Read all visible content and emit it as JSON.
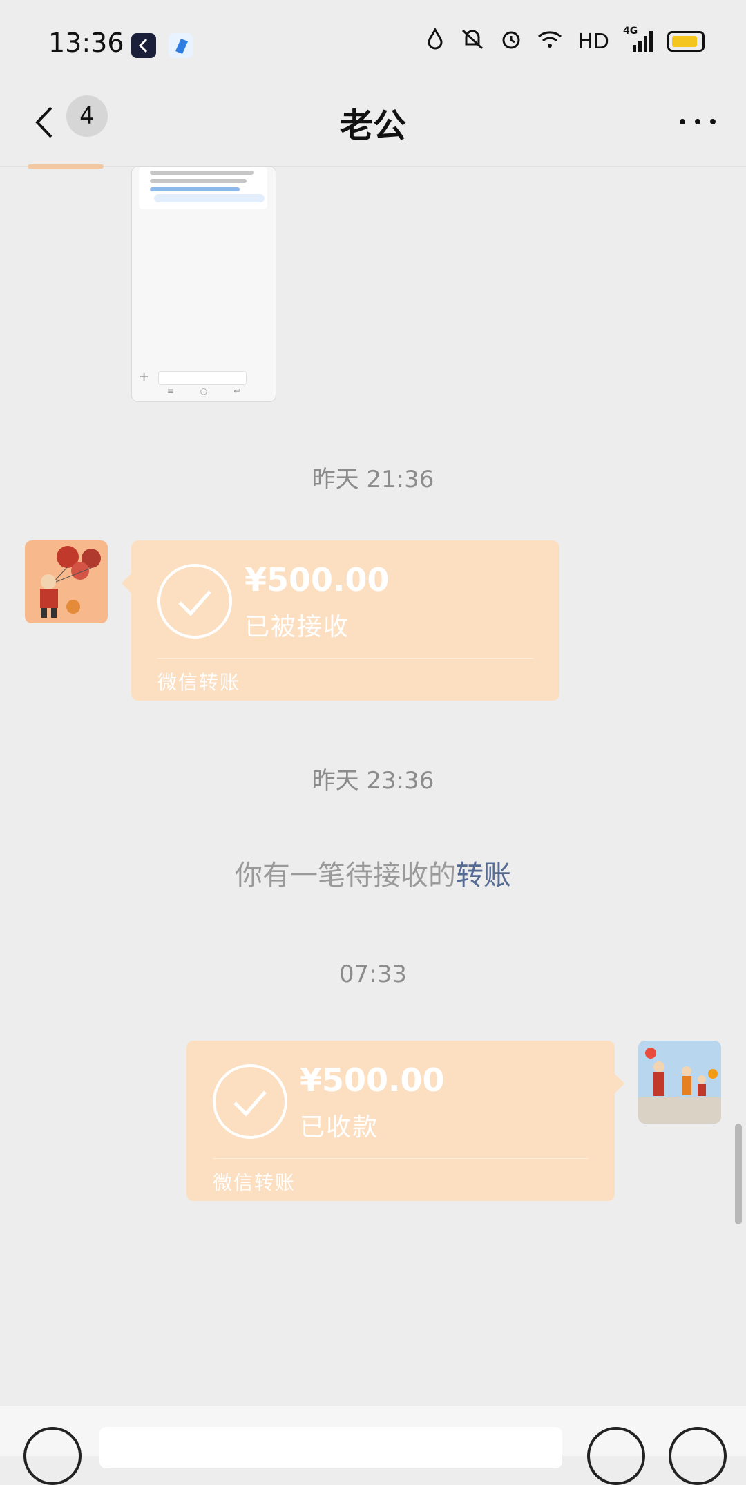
{
  "status_bar": {
    "time": "13:36",
    "network": "HD",
    "signal": "4G",
    "icons": [
      "app-dark-icon",
      "app-blue-icon",
      "drop-icon",
      "mute-icon",
      "alarm-icon",
      "wifi-icon",
      "signal-icon",
      "battery-icon"
    ],
    "battery_color": "#f4c51f"
  },
  "header": {
    "back_icon": "chevron-left-icon",
    "unread_count": "4",
    "title": "老公",
    "more_icon": "more-dots-icon"
  },
  "messages": [
    {
      "type": "timestamp",
      "text": "昨天 21:36"
    },
    {
      "type": "transfer",
      "side": "left",
      "amount": "¥500.00",
      "status": "已被接收",
      "footer": "微信转账",
      "avatar_icon": "balloon-kid-avatar"
    },
    {
      "type": "timestamp",
      "text": "昨天 23:36"
    },
    {
      "type": "system",
      "text": "你有一笔待接收的",
      "link": "转账"
    },
    {
      "type": "timestamp",
      "text": "07:33"
    },
    {
      "type": "transfer",
      "side": "right",
      "amount": "¥500.00",
      "status": "已收款",
      "footer": "微信转账",
      "avatar_icon": "family-2025-avatar"
    }
  ],
  "colors": {
    "background": "#ededed",
    "bubble": "#fcdfc1",
    "link": "#566b94"
  }
}
